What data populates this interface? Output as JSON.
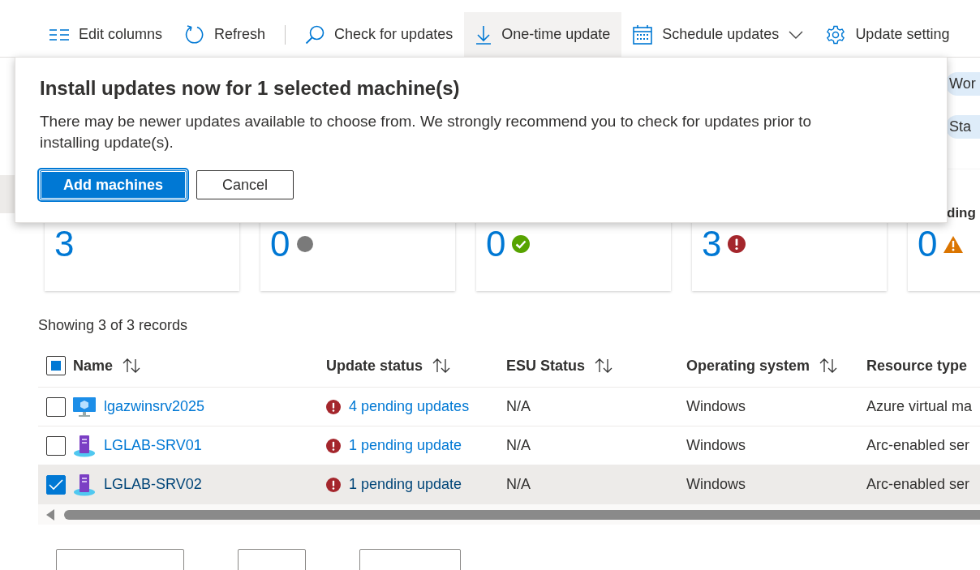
{
  "toolbar": {
    "groups": [
      [
        {
          "kind": "columns",
          "label": "Edit columns",
          "selected": false,
          "dropdown": false
        },
        {
          "kind": "refresh",
          "label": "Refresh",
          "selected": false,
          "dropdown": false
        }
      ],
      [
        {
          "kind": "search",
          "label": "Check for updates",
          "selected": false,
          "dropdown": false
        },
        {
          "kind": "download",
          "label": "One-time update",
          "selected": true,
          "dropdown": false
        },
        {
          "kind": "calendar",
          "label": "Schedule updates",
          "selected": false,
          "dropdown": true
        },
        {
          "kind": "gear",
          "label": "Update setting",
          "selected": false,
          "dropdown": false
        }
      ]
    ]
  },
  "filters": [
    "Wor",
    "Sta"
  ],
  "cards": [
    {
      "kind": "none",
      "value": "3"
    },
    {
      "kind": "unknown",
      "value": "0"
    },
    {
      "kind": "success",
      "value": "0"
    },
    {
      "kind": "error",
      "value": "3"
    },
    {
      "kind": "warning",
      "value": "0",
      "heading": "ding"
    }
  ],
  "dialog": {
    "title": "Install updates now for 1 selected machine(s)",
    "message": "There may be newer updates available to choose from. We strongly recommend you to check for updates prior to installing update(s).",
    "buttons": [
      {
        "label": "Add machines",
        "primary": true
      },
      {
        "label": "Cancel",
        "primary": false
      }
    ]
  },
  "records": "Showing 3 of 3 records",
  "table": {
    "select_all_partial": true,
    "columns": [
      {
        "label": "Name",
        "sortable": true
      },
      {
        "label": "Update status",
        "sortable": true
      },
      {
        "label": "ESU Status",
        "sortable": true
      },
      {
        "label": "Operating system",
        "sortable": true
      },
      {
        "label": "Resource type",
        "sortable": false
      }
    ],
    "rows": [
      {
        "selected": false,
        "kind": "vm",
        "name": "lgazwinsrv2025",
        "status": "4 pending updates",
        "esu": "N/A",
        "os": "Windows",
        "type": "Azure virtual ma"
      },
      {
        "selected": false,
        "kind": "server",
        "name": "LGLAB-SRV01",
        "status": "1 pending update",
        "esu": "N/A",
        "os": "Windows",
        "type": "Arc-enabled ser"
      },
      {
        "selected": true,
        "kind": "server",
        "name": "LGLAB-SRV02",
        "status": "1 pending update",
        "esu": "N/A",
        "os": "Windows",
        "type": "Arc-enabled ser"
      }
    ]
  }
}
